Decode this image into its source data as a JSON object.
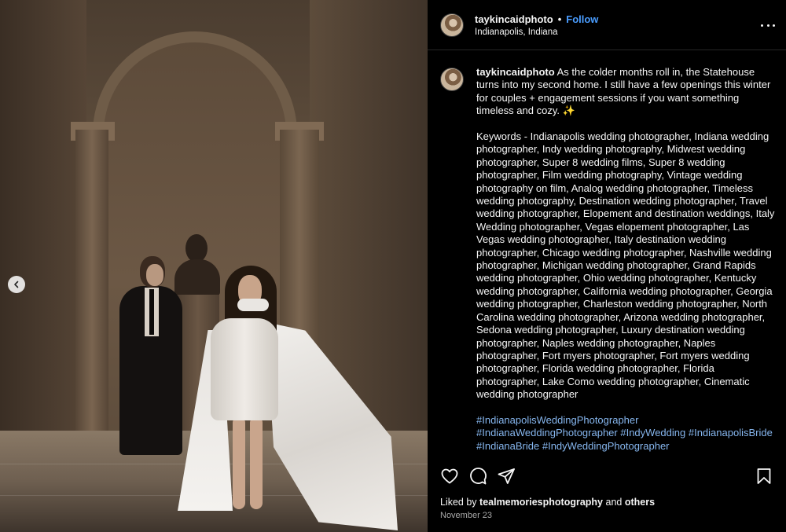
{
  "post": {
    "username": "taykincaidphoto",
    "follow_label": "Follow",
    "separator": "•",
    "location": "Indianapolis, Indiana",
    "caption": {
      "username": "taykincaidphoto",
      "intro": " As the colder months roll in, the Statehouse turns into my second home. I still have a few openings this winter for couples + engagement sessions if you want something timeless and cozy. ✨",
      "keywords": "Keywords - Indianapolis wedding photographer, Indiana wedding photographer, Indy wedding photography, Midwest wedding photographer, Super 8 wedding films, Super 8 wedding photographer, Film wedding photography, Vintage wedding photography on film, Analog wedding photographer, Timeless wedding photography, Destination wedding photographer, Travel wedding photographer, Elopement and destination weddings, Italy Wedding photographer, Vegas elopement photographer, Las Vegas wedding photographer, Italy destination wedding photographer, Chicago wedding photographer, Nashville wedding photographer, Michigan wedding photographer, Grand Rapids wedding photographer, Ohio wedding photographer, Kentucky wedding photographer, California wedding photographer, Georgia wedding photographer, Charleston wedding photographer, North Carolina wedding photographer, Arizona wedding photographer, Sedona wedding photographer, Luxury destination wedding photographer, Naples wedding photographer, Naples photographer, Fort myers photographer, Fort myers wedding photographer, Florida wedding photographer, Florida photographer, Lake Como wedding photographer, Cinematic wedding photographer",
      "hashtags": [
        "#IndianapolisWeddingPhotographer",
        "#IndianaWeddingPhotographer",
        "#IndyWedding",
        "#IndianapolisBride",
        "#IndianaBride",
        "#IndyWeddingPhotographer"
      ]
    },
    "likes": {
      "prefix": "Liked by ",
      "user": "tealmemoriesphotography",
      "middle": " and ",
      "others": "others"
    },
    "date": "November 23"
  },
  "icons": {
    "prev": "chevron-left-icon",
    "more": "more-horizontal-icon",
    "like": "heart-icon",
    "comment": "comment-icon",
    "share": "paper-plane-icon",
    "save": "bookmark-icon"
  },
  "colors": {
    "panel_bg": "#000000",
    "link": "#4a9dff",
    "hashtag": "#86b6ee",
    "muted": "#a8a8a8"
  }
}
